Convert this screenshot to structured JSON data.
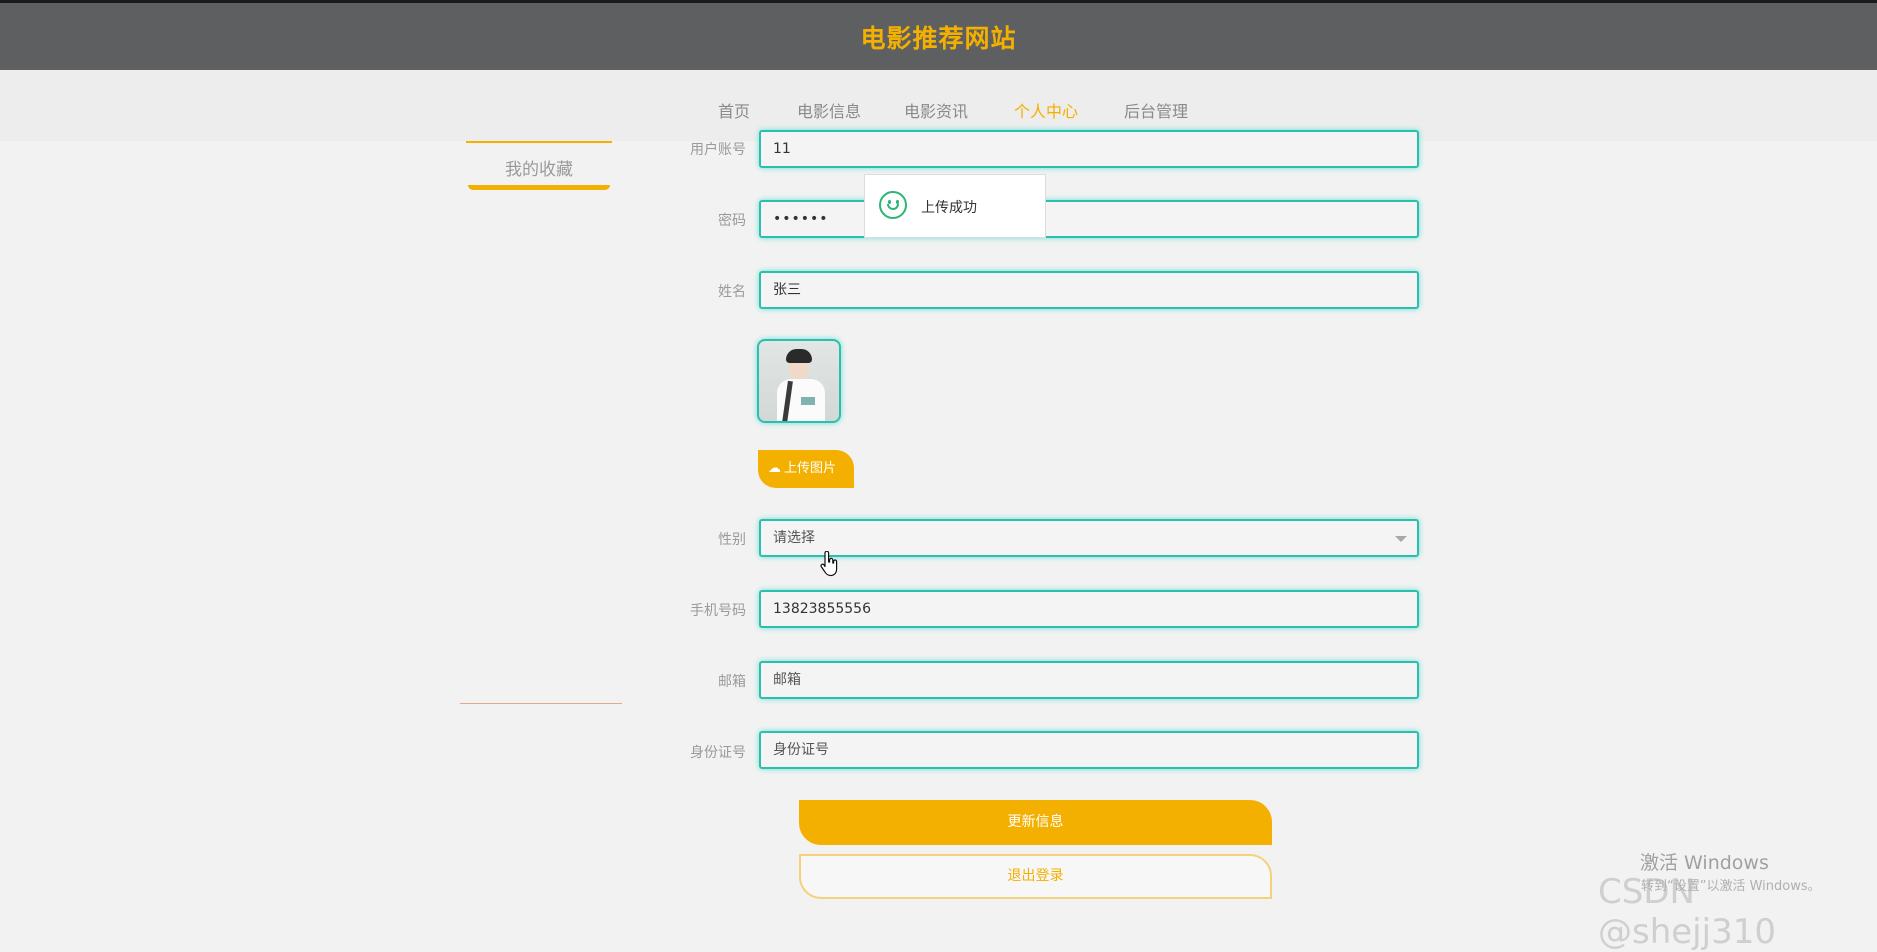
{
  "header": {
    "title": "电影推荐网站"
  },
  "nav": {
    "items": [
      {
        "label": "首页",
        "active": false
      },
      {
        "label": "电影信息",
        "active": false
      },
      {
        "label": "电影资讯",
        "active": false
      },
      {
        "label": "个人中心",
        "active": true
      },
      {
        "label": "后台管理",
        "active": false
      }
    ]
  },
  "sidebar": {
    "items": [
      {
        "label": "我的收藏"
      }
    ]
  },
  "form": {
    "account": {
      "label": "用户账号",
      "value": "11"
    },
    "password": {
      "label": "密码",
      "value": "••••••"
    },
    "name": {
      "label": "姓名",
      "value": "张三"
    },
    "upload_label": "上传图片",
    "gender": {
      "label": "性别",
      "placeholder": "请选择"
    },
    "phone": {
      "label": "手机号码",
      "value": "13823855556"
    },
    "email": {
      "label": "邮箱",
      "placeholder": "邮箱"
    },
    "id_card": {
      "label": "身份证号",
      "placeholder": "身份证号"
    },
    "update_button": "更新信息",
    "logout_button": "退出登录"
  },
  "toast": {
    "message": "上传成功"
  },
  "watermarks": {
    "activate_title": "激活 Windows",
    "activate_hint": "转到“设置”以激活 Windows。",
    "csdn": "CSDN @shejj310"
  },
  "colors": {
    "accent": "#f4b000",
    "field_border": "#2cbfae",
    "header_bg": "#5e5f61",
    "success": "#2bb673"
  },
  "icons": {
    "upload": "cloud-upload-icon",
    "toast": "smile-icon",
    "select": "chevron-down-icon",
    "cursor": "hand-cursor-icon"
  }
}
